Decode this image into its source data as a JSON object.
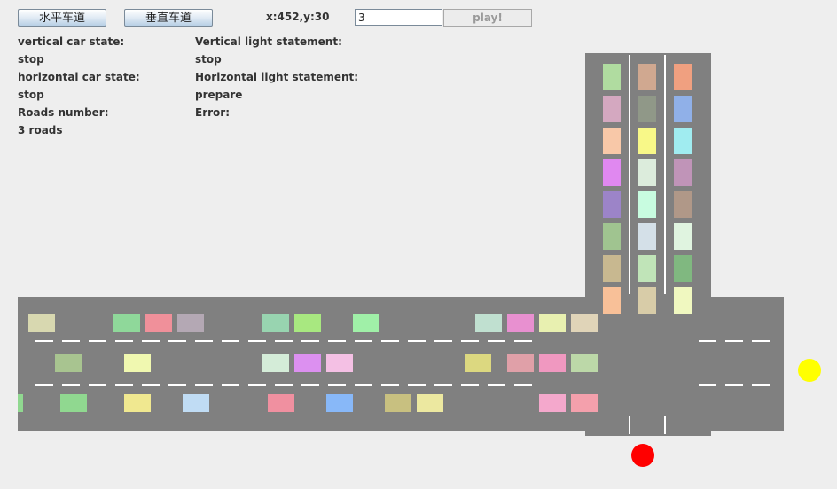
{
  "toolbar": {
    "horizontal_lane_button": "水平车道",
    "vertical_lane_button": "垂直车道",
    "coords": "x:452,y:30",
    "roads_input_value": "3",
    "play_button": "play!"
  },
  "status": {
    "vertical_car_state_label": "vertical car state:",
    "vertical_car_state_value": "stop",
    "horizontal_car_state_label": "horizontal car state:",
    "horizontal_car_state_value": "stop",
    "roads_number_label": "Roads number:",
    "roads_number_value": "3 roads",
    "vertical_light_label": "Vertical light statement:",
    "vertical_light_value": "stop",
    "horizontal_light_label": "Horizontal light statement:",
    "horizontal_light_value": "prepare",
    "error_label": "Error:",
    "error_value": ""
  },
  "colors": {
    "road": "#808080",
    "lane_marking": "#ffffff",
    "vertical_light": "#ff0000",
    "horizontal_light": "#ffff00"
  },
  "horizontal_cars": [
    [
      "#d8d8b0",
      "#8fd89a",
      "#f0909a",
      "#b4a8b4",
      "#98d4b0",
      "#a8e880",
      "#a0f0a8",
      "#c0e0d0",
      "#e890d0",
      "#e8f0b0",
      "#e0d4b8"
    ],
    [
      "#a8c490",
      "#f0f8b0",
      "#d4ecd8",
      "#dc90f0",
      "#f4c0e4",
      "#dcd880",
      "#e0a0a8",
      "#f098c0",
      "#bcd8a8"
    ],
    [
      "#90d890",
      "#90d890",
      "#f0e890",
      "#c0dcf4",
      "#f090a0",
      "#88b8f8",
      "#c8c080",
      "#ece8a0",
      "#f4a8cc",
      "#f4a0ac"
    ]
  ],
  "vertical_cars": [
    [
      "#b0dca0",
      "#d4a8c0",
      "#f8c8a8",
      "#e088f0",
      "#9c84c8",
      "#a0c490",
      "#c8b890",
      "#f8c098"
    ],
    [
      "#d0a890",
      "#909888",
      "#f8f888",
      "#dcecdc",
      "#c8fce0",
      "#d4e0e8",
      "#c0e4b8",
      "#d8cca8"
    ],
    [
      "#f0a080",
      "#90b0e8",
      "#a0ecf0",
      "#c094b8",
      "#b09888",
      "#e0f4e0",
      "#80b880",
      "#f0f8c0"
    ]
  ]
}
